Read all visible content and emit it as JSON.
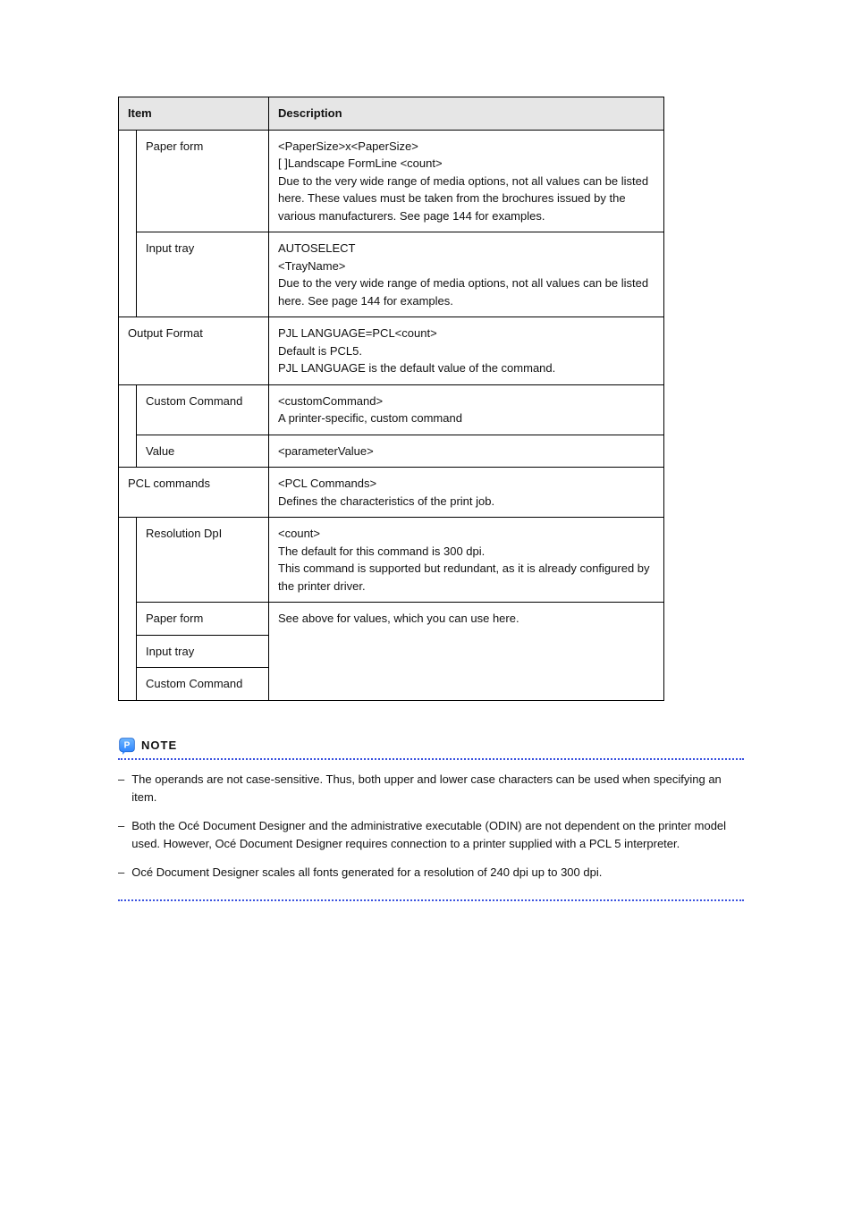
{
  "table": {
    "headers": {
      "item": "Item",
      "desc": "Description"
    },
    "rows": [
      {
        "sub": "",
        "label": "Paper form",
        "desc": "<PaperSize>x<PaperSize>\n[ ]Landscape FormLine <count>\nDue to the very wide range of media options, not all values can be listed here. These values must be taken from the brochures issued by the various manufacturers. See page 144 for examples."
      },
      {
        "sub": "",
        "label": "Input tray",
        "desc": "AUTOSELECT\n<TrayName>\nDue to the very wide range of media options, not all values can be listed here. See page 144 for examples."
      },
      {
        "sub2": true,
        "label": "Output Format",
        "desc": "PJL LANGUAGE=PCL<count>\nDefault is PCL5.\nPJL LANGUAGE is the default value of the command."
      },
      {
        "sub": "",
        "label": "Custom Command",
        "desc": "<customCommand>\nA printer-specific, custom command"
      },
      {
        "sub": "",
        "label": "Value",
        "desc": "<parameterValue>"
      },
      {
        "sub2": true,
        "label": "PCL commands",
        "desc": "<PCL Commands>\nDefines the characteristics of the print job."
      },
      {
        "sub": "",
        "label": "Resolution DpI",
        "desc": "<count>\nThe default for this command is 300 dpi.\nThis command is supported but redundant, as it is already configured by the printer driver."
      },
      {
        "sub": "",
        "label": "Paper form",
        "desc": "See above for values, which you can use here."
      },
      {
        "sub": "",
        "label": "Input tray",
        "desc": ""
      },
      {
        "sub": "",
        "label": "Custom Command",
        "desc": ""
      }
    ]
  },
  "note": {
    "label": "NOTE",
    "items": [
      "The operands are not case-sensitive. Thus, both upper and lower case characters can be used when specifying an item.",
      "Both the Océ Document Designer and the administrative executable (ODIN) are not dependent on the printer model used. However, Océ Document Designer requires connection to a printer supplied with a PCL 5 interpreter.",
      "Océ Document Designer scales all fonts generated for a resolution of 240 dpi up to 300 dpi."
    ]
  }
}
